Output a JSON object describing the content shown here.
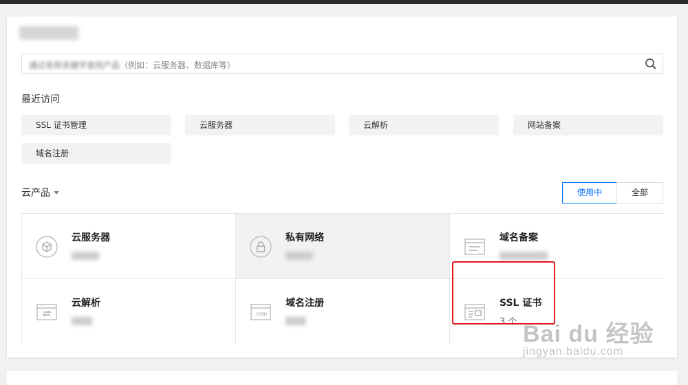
{
  "search": {
    "placeholder_prefix": "通过名称关键字查找产品",
    "placeholder_example": "（例如：云服务器、数据库等）"
  },
  "recent": {
    "label": "最近访问",
    "items": [
      {
        "label": "SSL 证书管理"
      },
      {
        "label": "云服务器"
      },
      {
        "label": "云解析"
      },
      {
        "label": "网站备案"
      },
      {
        "label": "域名注册"
      }
    ]
  },
  "products": {
    "label": "云产品",
    "filters": {
      "active": "使用中",
      "all": "全部"
    },
    "cards": [
      {
        "name": "云服务器",
        "icon": "cube-icon",
        "meta": ""
      },
      {
        "name": "私有网络",
        "icon": "lock-icon",
        "meta": ""
      },
      {
        "name": "域名备案",
        "icon": "document-icon",
        "meta": ""
      },
      {
        "name": "云解析",
        "icon": "dns-swap-icon",
        "meta": ""
      },
      {
        "name": "域名注册",
        "icon": "domain-com-icon",
        "meta": ""
      },
      {
        "name": "SSL 证书",
        "icon": "certificate-icon",
        "meta": "3 个"
      }
    ]
  },
  "watermark": {
    "line1": "Bai du 经验",
    "line2": "jingyan.baidu.com"
  },
  "colors": {
    "accent": "#006eff",
    "highlight": "#e3141b",
    "hover_bg": "#f2f2f2"
  }
}
